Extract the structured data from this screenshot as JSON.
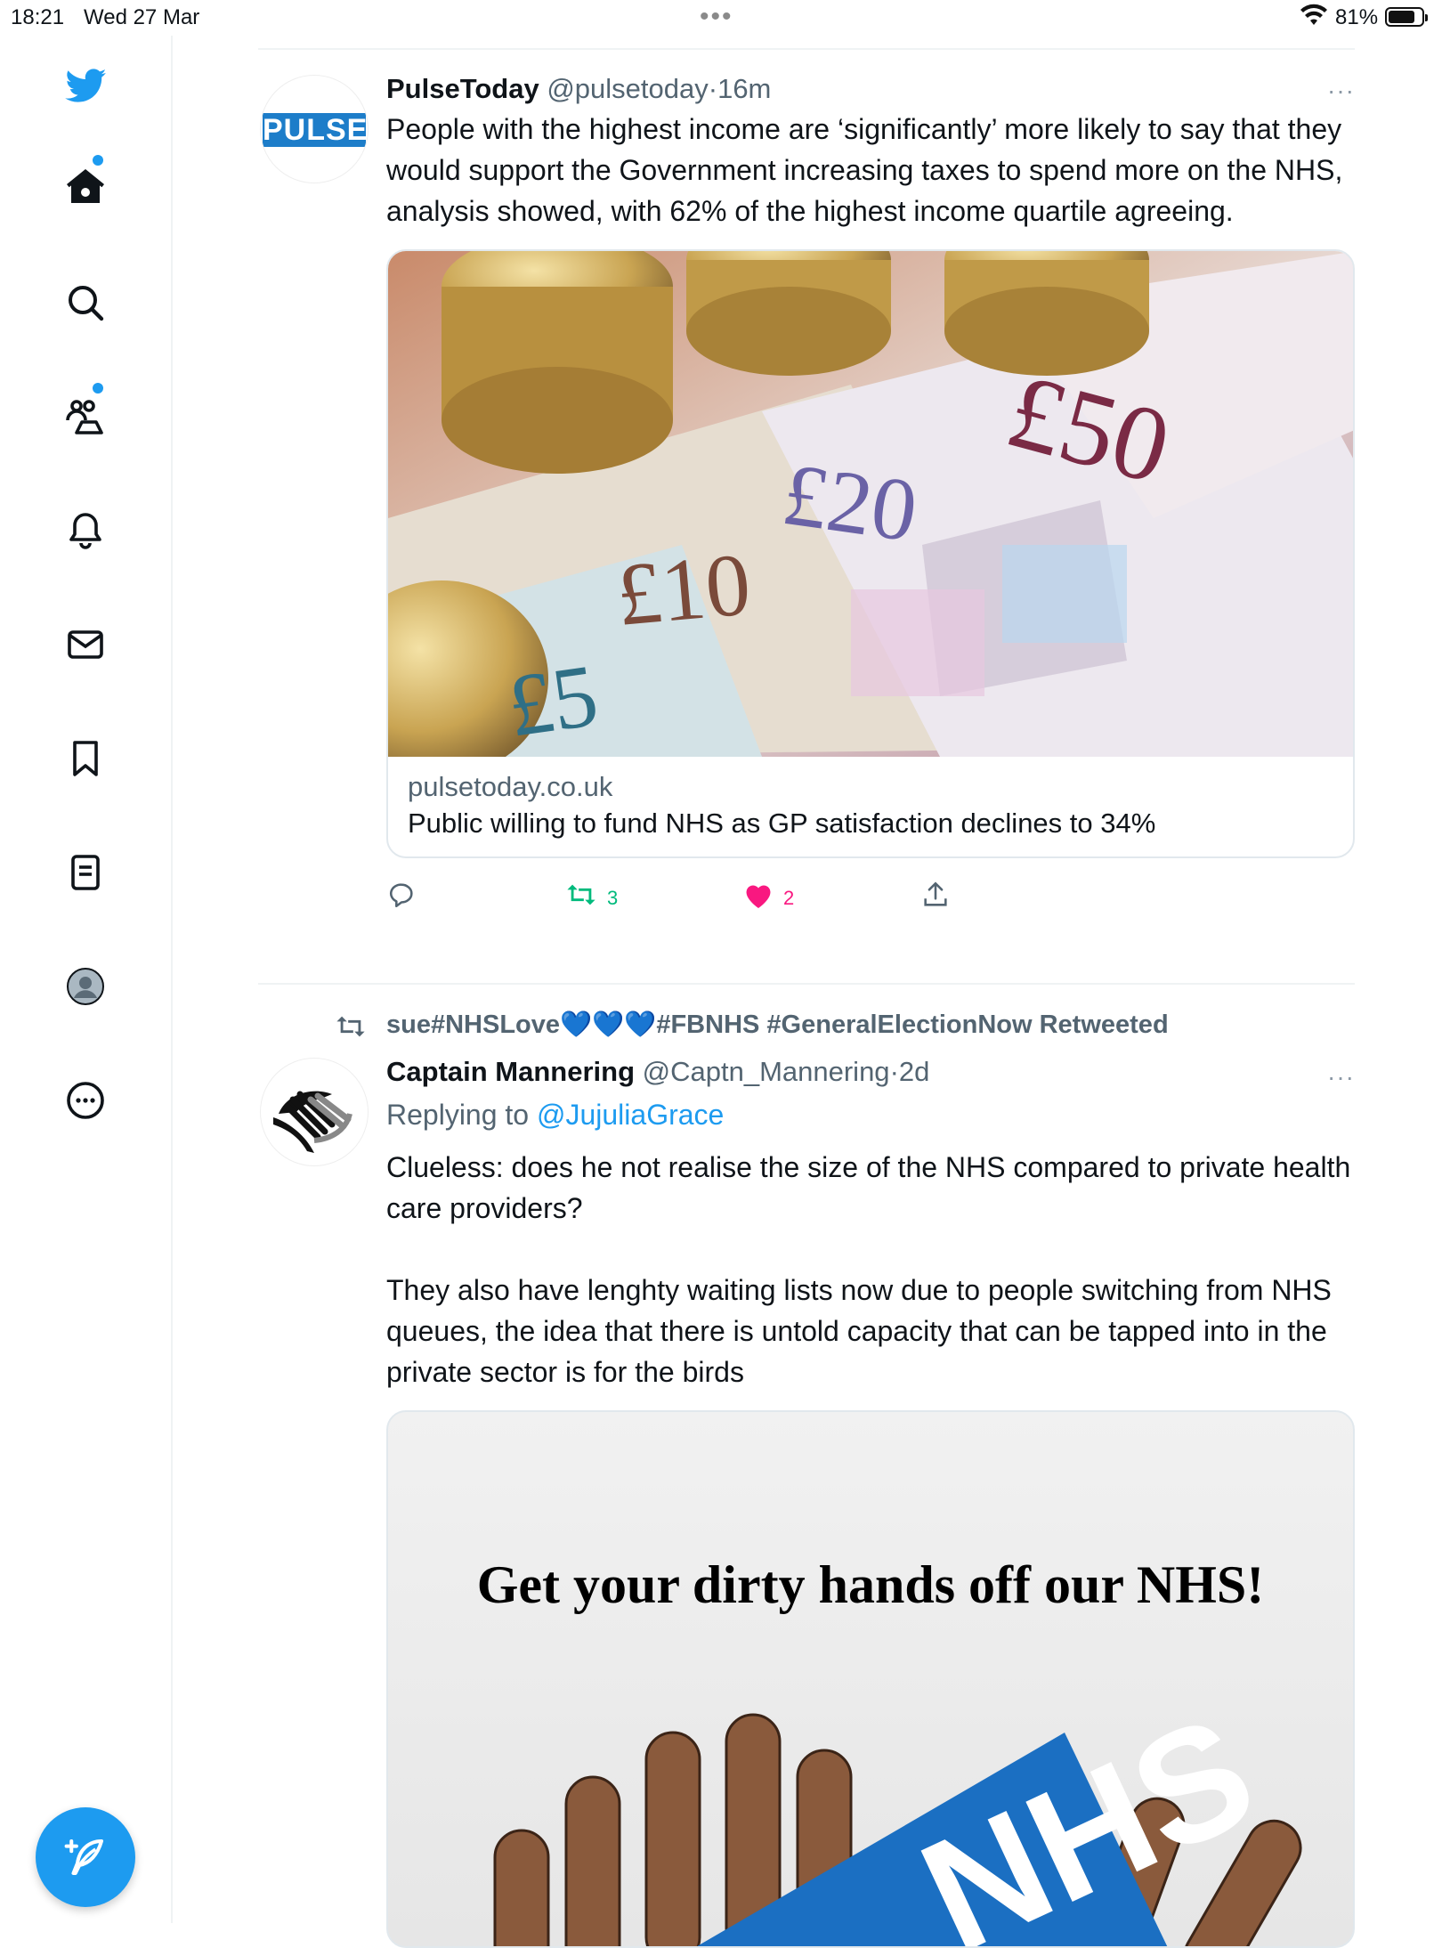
{
  "status": {
    "time": "18:21",
    "date": "Wed 27 Mar",
    "battery": "81%",
    "battery_level": 0.81
  },
  "nav": {
    "items": [
      "home",
      "explore",
      "communities",
      "notifications",
      "messages",
      "bookmarks",
      "lists",
      "profile",
      "more"
    ],
    "accent": "#1d9bf0"
  },
  "tweet1": {
    "avatar_text": "PULSE",
    "name": "PulseToday",
    "handle": "@pulsetoday",
    "sep": "·",
    "time": "16m",
    "more": "···",
    "text": "People with the highest income are ‘significantly’ more likely to say that they would support the Government increasing taxes to spend more on the NHS, analysis showed, with 62% of the highest income quartile agreeing.",
    "card": {
      "domain": "pulsetoday.co.uk",
      "title": "Public willing to fund NHS as GP satisfaction declines to 34%",
      "notes": [
        "£50",
        "£20",
        "£10",
        "£5"
      ]
    },
    "retweets": "3",
    "likes": "2"
  },
  "tweet2": {
    "retweeted_by": "sue#NHSLove💙💙💙#FBNHS #GeneralElectionNow Retweeted",
    "name": "Captain Mannering",
    "handle": "@Captn_Mannering",
    "sep": "·",
    "time": "2d",
    "more": "···",
    "replying_label": "Replying to",
    "replying_to": "@JujuliaGrace",
    "text_p1": "Clueless: does he not realise the size of the NHS compared to private health care providers?",
    "text_p2": "They also have lenghty waiting lists now due to people switching from NHS queues, the idea that there is untold capacity that can be tapped into in the private sector is for the birds",
    "media_caption": "Get your dirty hands off our NHS!",
    "media_logo": "NHS"
  }
}
